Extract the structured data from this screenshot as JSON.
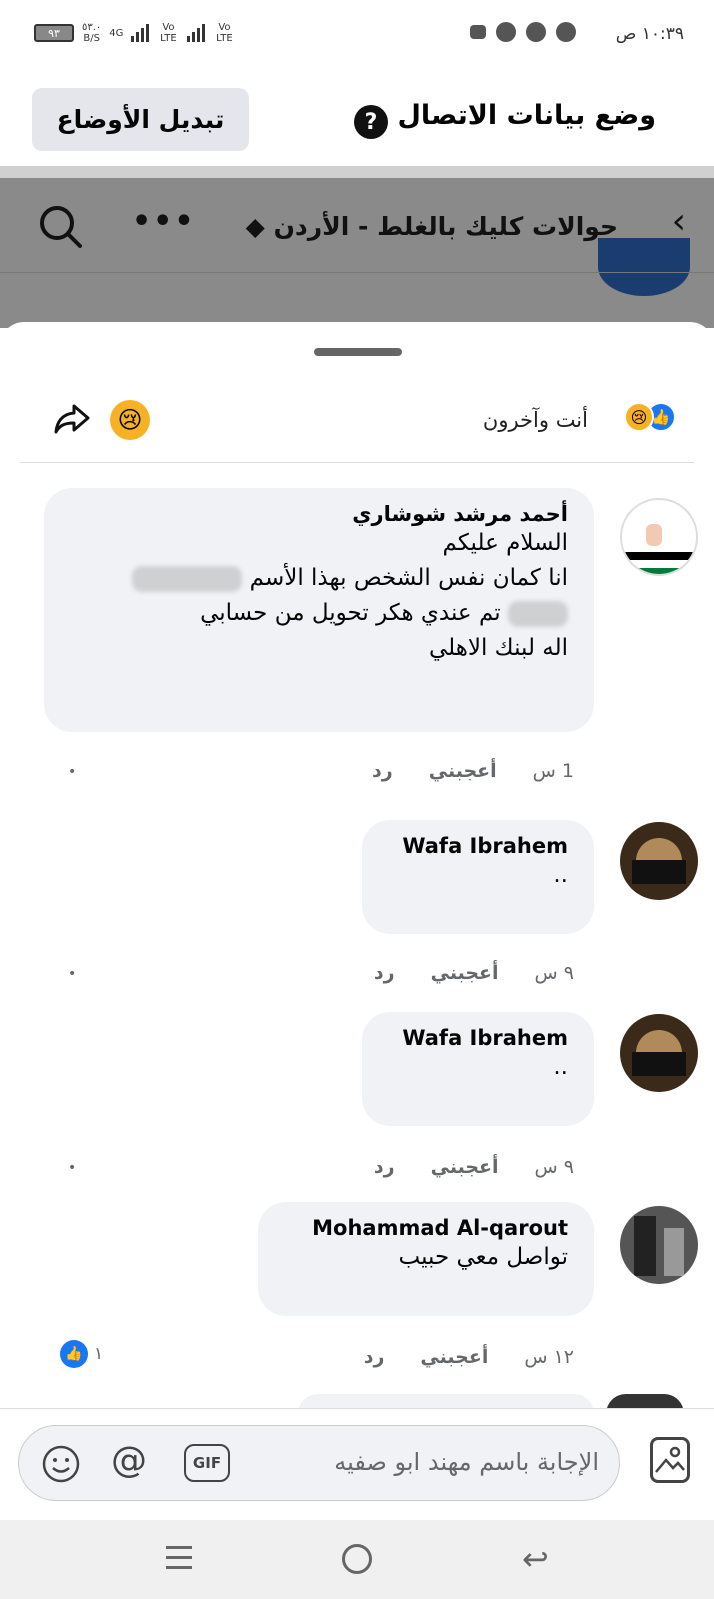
{
  "status_bar": {
    "time": "١٠:٣٩ ص",
    "battery": "٩٣",
    "net_speed": "٥٣.٠",
    "net_unit": "B/S",
    "net_type": "4G",
    "volte1": "Vo LTE",
    "volte2": "Vo LTE"
  },
  "data_mode": {
    "title": "وضع بيانات الاتصال",
    "help_glyph": "?",
    "switch_button": "تبديل الأوضاع"
  },
  "header": {
    "group_title": "حوالات كليك بالغلط - الأردن",
    "more_glyph": "•••",
    "back_glyph": "‹"
  },
  "reactions": {
    "summary_text": "أنت وآخرون"
  },
  "comments": [
    {
      "author": "أحمد مرشد شوشاري",
      "lines": [
        "السلام عليكم",
        "انا كمان نفس الشخص بهذا الأسم",
        "تم عندي هكر تحويل من حسابي",
        "اله لبنك الاهلي"
      ],
      "time": "1 س",
      "like": "أعجبني",
      "reply": "رد"
    },
    {
      "author": "Wafa Ibrahem",
      "text": "..",
      "time": "٩ س",
      "like": "أعجبني",
      "reply": "رد"
    },
    {
      "author": "Wafa Ibrahem",
      "text": "..",
      "time": "٩ س",
      "like": "أعجبني",
      "reply": "رد"
    },
    {
      "author": "Mohammad Al-qarout",
      "text": "تواصل معي حبيب",
      "time": "١٢ س",
      "like": "أعجبني",
      "reply": "رد",
      "like_count": "١"
    }
  ],
  "reply_bar": {
    "placeholder": "الإجابة باسم مهند ابو صفيه",
    "gif_label": "GIF",
    "at_glyph": "@"
  },
  "colors": {
    "accent": "#1877f2",
    "bubble": "#f0f2f5",
    "overlay": "#8a8a8a"
  }
}
